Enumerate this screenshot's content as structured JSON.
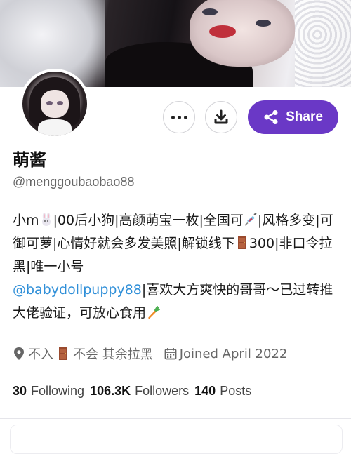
{
  "profile": {
    "display_name": "萌酱",
    "handle": "@menggoubaobao88",
    "bio": {
      "part1": "小m",
      "part2": "|00后小狗|高颜萌宝一枚|全国可",
      "part3": "|风格多变|可御可萝|心情好就会多发美照|解锁线下",
      "part4": "300|非口令拉黑|唯一小号",
      "mention": "@babydollpuppy88",
      "part5": "|喜欢大方爽快的哥哥～已过转推大佬验证，可放心食用"
    },
    "location_part1": "不入",
    "location_part2": "不会 其余拉黑",
    "joined": "Joined April 2022"
  },
  "stats": {
    "following_count": "30",
    "following_label": "Following",
    "followers_count": "106.3K",
    "followers_label": "Followers",
    "posts_count": "140",
    "posts_label": "Posts"
  },
  "actions": {
    "share_label": "Share"
  },
  "icons": [
    "more-icon",
    "download-icon",
    "share-icon",
    "location-pin-icon",
    "calendar-icon",
    "rabbit-emoji-icon",
    "syringe-emoji-icon",
    "door-emoji-icon",
    "carrot-emoji-icon"
  ],
  "colors": {
    "accent": "#6a38c6",
    "mention": "#2f8fd8",
    "muted": "#666666"
  }
}
